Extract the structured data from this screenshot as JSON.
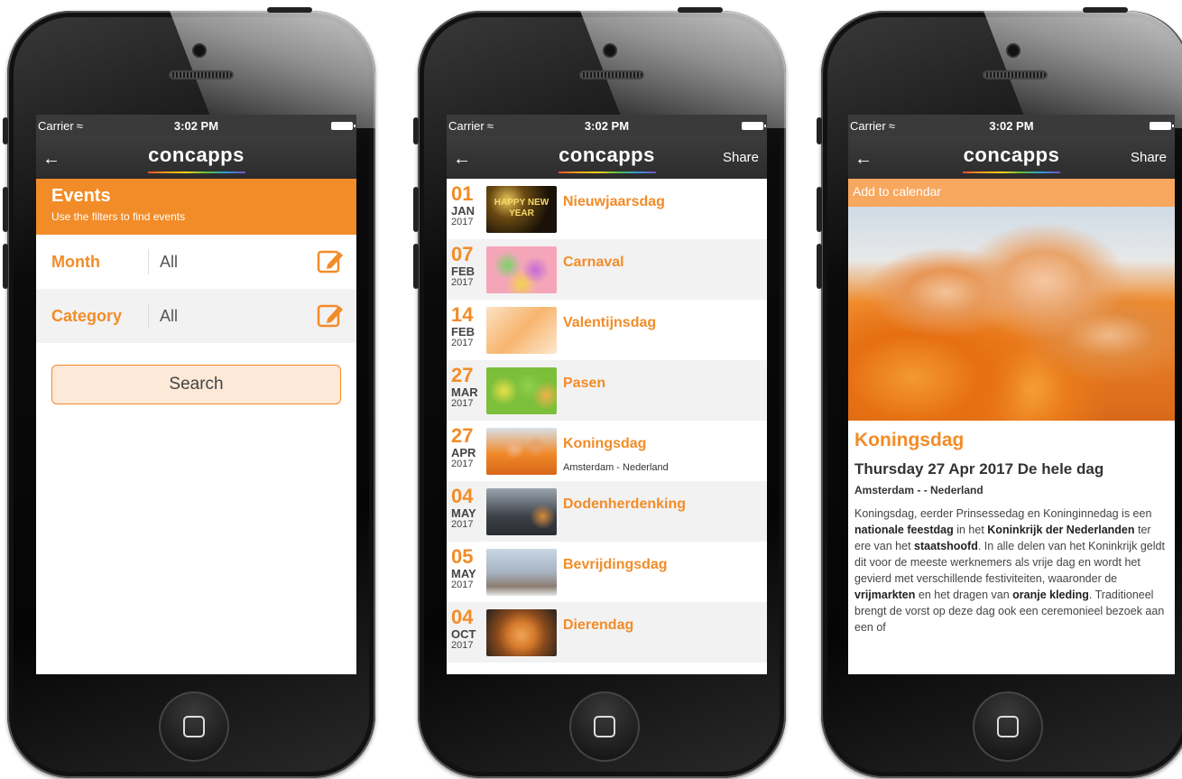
{
  "status": {
    "carrier": "Carrier",
    "time": "3:02 PM"
  },
  "app": {
    "logo": "concapps",
    "share_label": "Share"
  },
  "filters_screen": {
    "header_title": "Events",
    "header_subtitle": "Use the filters to find events",
    "filters": [
      {
        "label": "Month",
        "value": "All"
      },
      {
        "label": "Category",
        "value": "All"
      }
    ],
    "search_label": "Search"
  },
  "list_screen": {
    "items": [
      {
        "day": "01",
        "month": "JAN",
        "year": "2017",
        "name": "Nieuwjaarsdag",
        "location": "",
        "thumb_text": "HAPPY NEW YEAR"
      },
      {
        "day": "07",
        "month": "FEB",
        "year": "2017",
        "name": "Carnaval",
        "location": ""
      },
      {
        "day": "14",
        "month": "FEB",
        "year": "2017",
        "name": "Valentijnsdag",
        "location": ""
      },
      {
        "day": "27",
        "month": "MAR",
        "year": "2017",
        "name": "Pasen",
        "location": ""
      },
      {
        "day": "27",
        "month": "APR",
        "year": "2017",
        "name": "Koningsdag",
        "location": "Amsterdam - Nederland"
      },
      {
        "day": "04",
        "month": "MAY",
        "year": "2017",
        "name": "Dodenherdenking",
        "location": ""
      },
      {
        "day": "05",
        "month": "MAY",
        "year": "2017",
        "name": "Bevrijdingsdag",
        "location": ""
      },
      {
        "day": "04",
        "month": "OCT",
        "year": "2017",
        "name": "Dierendag",
        "location": ""
      }
    ]
  },
  "detail_screen": {
    "add_to_calendar": "Add to calendar",
    "title": "Koningsdag",
    "date_line": "Thursday 27 Apr 2017 De hele dag",
    "location": "Amsterdam - - Nederland",
    "body_parts": {
      "p1": "Koningsdag, eerder Prinsessedag en Koninginnedag is een ",
      "b1": "nationale feestdag",
      "p2": " in het ",
      "b2": "Koninkrijk der Nederlanden",
      "p3": " ter ere van het ",
      "b3": "staatshoofd",
      "p4": ". In alle delen van het Koninkrijk geldt dit voor de meeste werknemers als vrije dag en wordt het gevierd met verschillende festiviteiten, waaronder de ",
      "b4": "vrijmarkten",
      "p5": " en het dragen van ",
      "b5": "oranje kleding",
      "p6": ". Traditioneel brengt de vorst op deze dag ook een ceremonieel bezoek aan een of"
    }
  },
  "colors": {
    "accent": "#f28c28",
    "navbar": "#333333"
  }
}
